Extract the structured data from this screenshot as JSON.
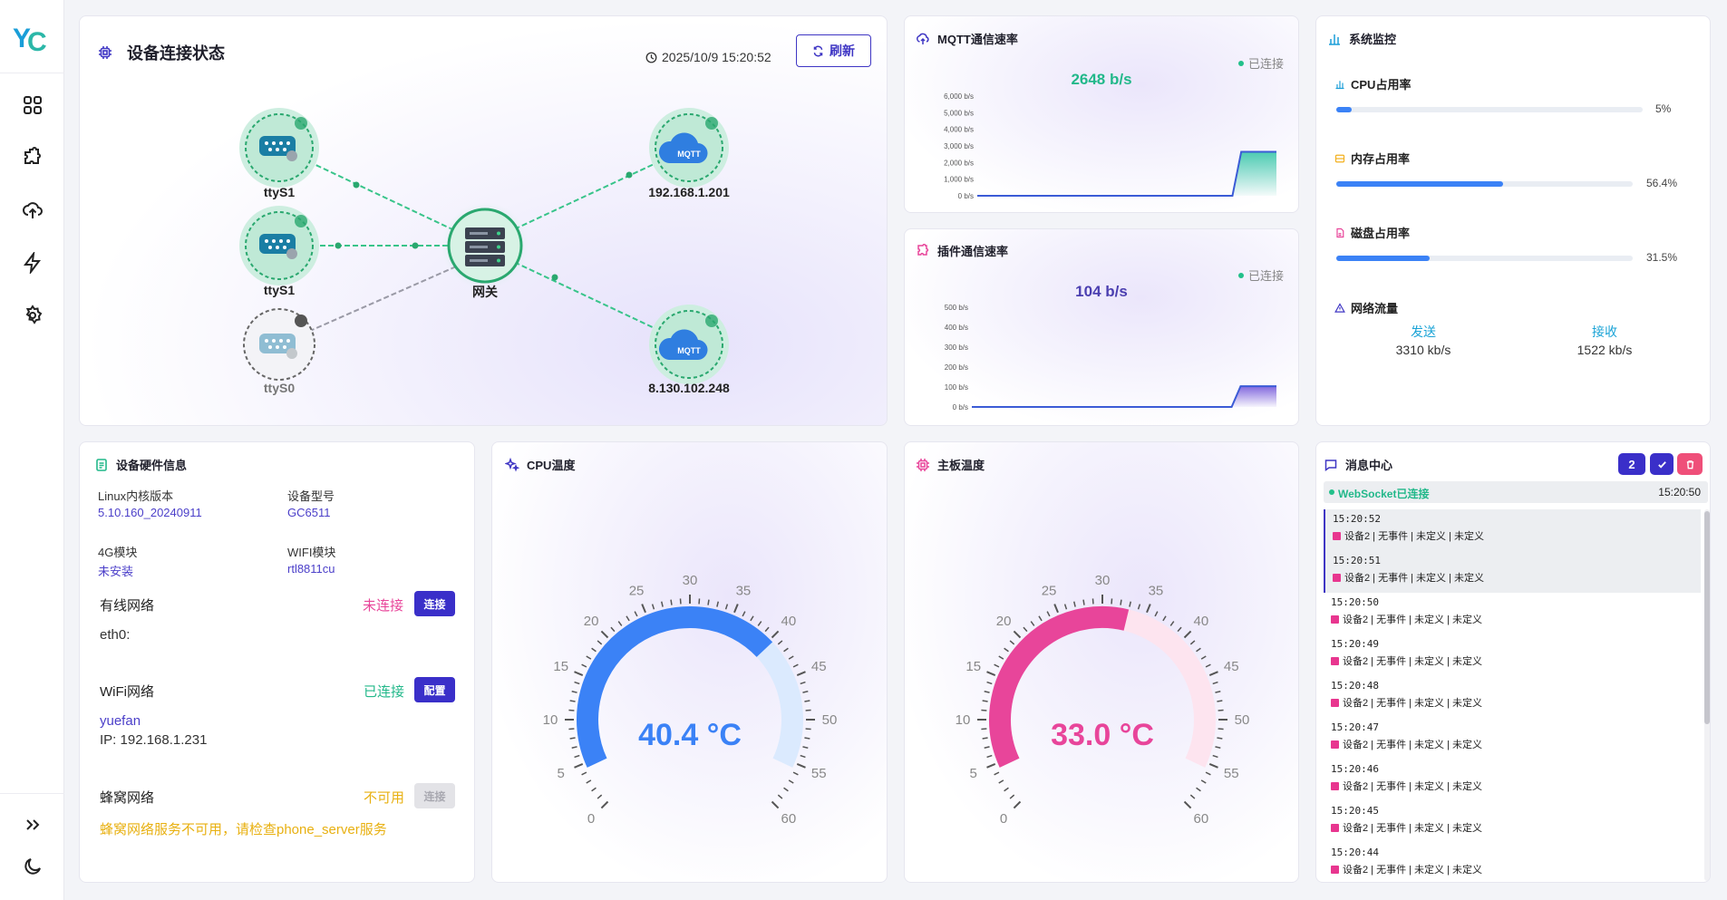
{
  "sidebar": {
    "items": [
      "dashboard-icon",
      "plugin-icon",
      "upload-cloud-icon",
      "lightning-icon",
      "settings-icon"
    ],
    "bottom": [
      "expand-icon",
      "moon-icon"
    ]
  },
  "topology": {
    "title": "设备连接状态",
    "timestamp": "2025/10/9 15:20:52",
    "refresh_label": "刷新",
    "nodes": {
      "serial1": "ttyS1",
      "serial2": "ttyS1",
      "serial3": "ttyS0",
      "gateway": "网关",
      "mqtt1": "192.168.1.201",
      "mqtt2": "8.130.102.248",
      "mqtt_badge": "MQTT"
    }
  },
  "mqtt_rate": {
    "title": "MQTT通信速率",
    "status": "已连接",
    "value": "2648 b/s",
    "chart_data": {
      "type": "area",
      "ylabel": "",
      "yticks": [
        "6,000 b/s",
        "5,000 b/s",
        "4,000 b/s",
        "3,000 b/s",
        "2,000 b/s",
        "1,000 b/s",
        "0 b/s"
      ],
      "ylim": [
        0,
        6000
      ],
      "values": [
        0,
        0,
        0,
        0,
        0,
        0,
        0,
        0,
        0,
        0,
        0,
        0,
        0,
        0,
        0,
        0,
        0,
        0,
        0,
        0,
        0,
        0,
        0,
        0,
        0,
        0,
        0,
        0,
        0,
        0,
        2648,
        2648,
        2648,
        2648,
        2648
      ],
      "color": "#3b5bd6",
      "fill": "#2ec4a4"
    }
  },
  "plugin_rate": {
    "title": "插件通信速率",
    "status": "已连接",
    "value": "104 b/s",
    "chart_data": {
      "type": "area",
      "yticks": [
        "500 b/s",
        "400 b/s",
        "300 b/s",
        "200 b/s",
        "100 b/s",
        "0 b/s"
      ],
      "ylim": [
        0,
        500
      ],
      "values": [
        0,
        0,
        0,
        0,
        0,
        0,
        0,
        0,
        0,
        0,
        0,
        0,
        0,
        0,
        0,
        0,
        0,
        0,
        0,
        0,
        0,
        0,
        0,
        0,
        0,
        0,
        0,
        0,
        0,
        0,
        104,
        104,
        104,
        104,
        104
      ],
      "color": "#3b5bd6",
      "fill": "#6d4fd8"
    }
  },
  "system": {
    "title": "系统监控",
    "cpu": {
      "label": "CPU占用率",
      "percent": 5,
      "text": "5%"
    },
    "mem": {
      "label": "内存占用率",
      "percent": 56.4,
      "text": "56.4%"
    },
    "disk": {
      "label": "磁盘占用率",
      "percent": 31.5,
      "text": "31.5%"
    },
    "net": {
      "label": "网络流量",
      "send_label": "发送",
      "send_value": "3310 kb/s",
      "recv_label": "接收",
      "recv_value": "1522 kb/s"
    }
  },
  "hardware": {
    "title": "设备硬件信息",
    "kernel_label": "Linux内核版本",
    "kernel_value": "5.10.160_20240911",
    "model_label": "设备型号",
    "model_value": "GC6511",
    "g4_label": "4G模块",
    "g4_value": "未安装",
    "wifi_mod_label": "WIFI模块",
    "wifi_mod_value": "rtl8811cu",
    "wired": {
      "title": "有线网络",
      "status": "未连接",
      "button": "连接",
      "iface": "eth0:"
    },
    "wifi": {
      "title": "WiFi网络",
      "status": "已连接",
      "button": "配置",
      "ssid": "yuefan",
      "ip": "IP: 192.168.1.231"
    },
    "cell": {
      "title": "蜂窝网络",
      "status": "不可用",
      "button": "连接",
      "warning": "蜂窝网络服务不可用，请检查phone_server服务"
    }
  },
  "cpu_temp": {
    "title": "CPU温度",
    "value": 40.4,
    "text": "40.4 °C",
    "min": 0,
    "max": 60,
    "labels": [
      "0",
      "5",
      "10",
      "15",
      "20",
      "25",
      "30",
      "35",
      "40",
      "45",
      "50",
      "55",
      "60"
    ],
    "color": "#3b82f6",
    "track": "#dbeafe"
  },
  "board_temp": {
    "title": "主板温度",
    "value": 33.0,
    "text": "33.0 °C",
    "min": 0,
    "max": 60,
    "labels": [
      "0",
      "5",
      "10",
      "15",
      "20",
      "25",
      "30",
      "35",
      "40",
      "45",
      "50",
      "55",
      "60"
    ],
    "color": "#e8459a",
    "track": "#fde4ef"
  },
  "messages": {
    "title": "消息中心",
    "count": "2",
    "ws_status": "WebSocket已连接",
    "ws_time": "15:20:50",
    "items": [
      {
        "time": "15:20:52",
        "text": "设备2 | 无事件 | 未定义 | 未定义",
        "highlight": true
      },
      {
        "time": "15:20:51",
        "text": "设备2 | 无事件 | 未定义 | 未定义",
        "highlight": true
      },
      {
        "time": "15:20:50",
        "text": "设备2 | 无事件 | 未定义 | 未定义",
        "highlight": false
      },
      {
        "time": "15:20:49",
        "text": "设备2 | 无事件 | 未定义 | 未定义",
        "highlight": false
      },
      {
        "time": "15:20:48",
        "text": "设备2 | 无事件 | 未定义 | 未定义",
        "highlight": false
      },
      {
        "time": "15:20:47",
        "text": "设备2 | 无事件 | 未定义 | 未定义",
        "highlight": false
      },
      {
        "time": "15:20:46",
        "text": "设备2 | 无事件 | 未定义 | 未定义",
        "highlight": false
      },
      {
        "time": "15:20:45",
        "text": "设备2 | 无事件 | 未定义 | 未定义",
        "highlight": false
      },
      {
        "time": "15:20:44",
        "text": "设备2 | 无事件 | 未定义 | 未定义",
        "highlight": false
      }
    ]
  }
}
